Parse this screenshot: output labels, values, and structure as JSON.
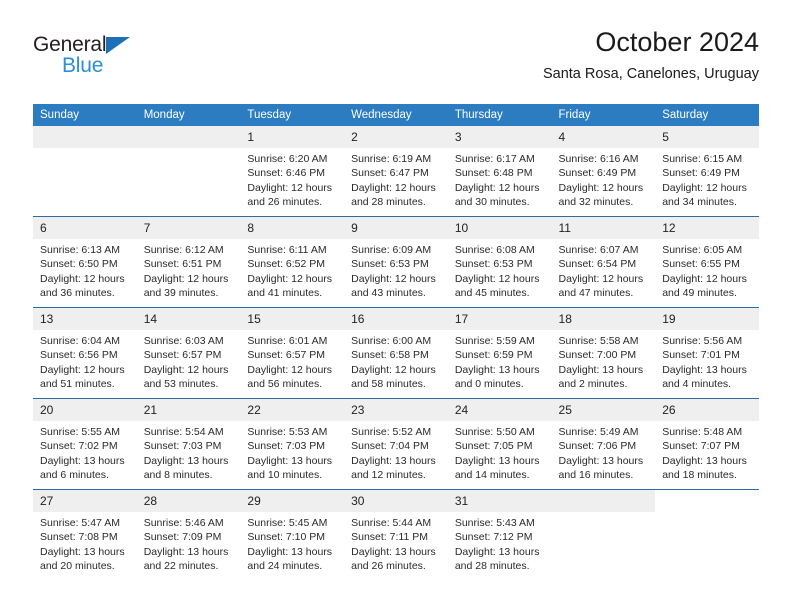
{
  "brand": {
    "word1": "General",
    "word2": "Blue",
    "triangle_color": "#1d6fb8",
    "blue_color": "#2b8fd6"
  },
  "header": {
    "title": "October 2024",
    "subtitle": "Santa Rosa, Canelones, Uruguay",
    "header_bg": "#2b7cc0",
    "row_divider_color": "#2b6ca8",
    "daynum_bg": "#efefef"
  },
  "weekdays": [
    "Sunday",
    "Monday",
    "Tuesday",
    "Wednesday",
    "Thursday",
    "Friday",
    "Saturday"
  ],
  "weeks": [
    [
      {
        "type": "empty"
      },
      {
        "type": "empty"
      },
      {
        "type": "day",
        "date": "1",
        "sunrise": "Sunrise: 6:20 AM",
        "sunset": "Sunset: 6:46 PM",
        "daylight": "Daylight: 12 hours and 26 minutes."
      },
      {
        "type": "day",
        "date": "2",
        "sunrise": "Sunrise: 6:19 AM",
        "sunset": "Sunset: 6:47 PM",
        "daylight": "Daylight: 12 hours and 28 minutes."
      },
      {
        "type": "day",
        "date": "3",
        "sunrise": "Sunrise: 6:17 AM",
        "sunset": "Sunset: 6:48 PM",
        "daylight": "Daylight: 12 hours and 30 minutes."
      },
      {
        "type": "day",
        "date": "4",
        "sunrise": "Sunrise: 6:16 AM",
        "sunset": "Sunset: 6:49 PM",
        "daylight": "Daylight: 12 hours and 32 minutes."
      },
      {
        "type": "day",
        "date": "5",
        "sunrise": "Sunrise: 6:15 AM",
        "sunset": "Sunset: 6:49 PM",
        "daylight": "Daylight: 12 hours and 34 minutes."
      }
    ],
    [
      {
        "type": "day",
        "date": "6",
        "sunrise": "Sunrise: 6:13 AM",
        "sunset": "Sunset: 6:50 PM",
        "daylight": "Daylight: 12 hours and 36 minutes."
      },
      {
        "type": "day",
        "date": "7",
        "sunrise": "Sunrise: 6:12 AM",
        "sunset": "Sunset: 6:51 PM",
        "daylight": "Daylight: 12 hours and 39 minutes."
      },
      {
        "type": "day",
        "date": "8",
        "sunrise": "Sunrise: 6:11 AM",
        "sunset": "Sunset: 6:52 PM",
        "daylight": "Daylight: 12 hours and 41 minutes."
      },
      {
        "type": "day",
        "date": "9",
        "sunrise": "Sunrise: 6:09 AM",
        "sunset": "Sunset: 6:53 PM",
        "daylight": "Daylight: 12 hours and 43 minutes."
      },
      {
        "type": "day",
        "date": "10",
        "sunrise": "Sunrise: 6:08 AM",
        "sunset": "Sunset: 6:53 PM",
        "daylight": "Daylight: 12 hours and 45 minutes."
      },
      {
        "type": "day",
        "date": "11",
        "sunrise": "Sunrise: 6:07 AM",
        "sunset": "Sunset: 6:54 PM",
        "daylight": "Daylight: 12 hours and 47 minutes."
      },
      {
        "type": "day",
        "date": "12",
        "sunrise": "Sunrise: 6:05 AM",
        "sunset": "Sunset: 6:55 PM",
        "daylight": "Daylight: 12 hours and 49 minutes."
      }
    ],
    [
      {
        "type": "day",
        "date": "13",
        "sunrise": "Sunrise: 6:04 AM",
        "sunset": "Sunset: 6:56 PM",
        "daylight": "Daylight: 12 hours and 51 minutes."
      },
      {
        "type": "day",
        "date": "14",
        "sunrise": "Sunrise: 6:03 AM",
        "sunset": "Sunset: 6:57 PM",
        "daylight": "Daylight: 12 hours and 53 minutes."
      },
      {
        "type": "day",
        "date": "15",
        "sunrise": "Sunrise: 6:01 AM",
        "sunset": "Sunset: 6:57 PM",
        "daylight": "Daylight: 12 hours and 56 minutes."
      },
      {
        "type": "day",
        "date": "16",
        "sunrise": "Sunrise: 6:00 AM",
        "sunset": "Sunset: 6:58 PM",
        "daylight": "Daylight: 12 hours and 58 minutes."
      },
      {
        "type": "day",
        "date": "17",
        "sunrise": "Sunrise: 5:59 AM",
        "sunset": "Sunset: 6:59 PM",
        "daylight": "Daylight: 13 hours and 0 minutes."
      },
      {
        "type": "day",
        "date": "18",
        "sunrise": "Sunrise: 5:58 AM",
        "sunset": "Sunset: 7:00 PM",
        "daylight": "Daylight: 13 hours and 2 minutes."
      },
      {
        "type": "day",
        "date": "19",
        "sunrise": "Sunrise: 5:56 AM",
        "sunset": "Sunset: 7:01 PM",
        "daylight": "Daylight: 13 hours and 4 minutes."
      }
    ],
    [
      {
        "type": "day",
        "date": "20",
        "sunrise": "Sunrise: 5:55 AM",
        "sunset": "Sunset: 7:02 PM",
        "daylight": "Daylight: 13 hours and 6 minutes."
      },
      {
        "type": "day",
        "date": "21",
        "sunrise": "Sunrise: 5:54 AM",
        "sunset": "Sunset: 7:03 PM",
        "daylight": "Daylight: 13 hours and 8 minutes."
      },
      {
        "type": "day",
        "date": "22",
        "sunrise": "Sunrise: 5:53 AM",
        "sunset": "Sunset: 7:03 PM",
        "daylight": "Daylight: 13 hours and 10 minutes."
      },
      {
        "type": "day",
        "date": "23",
        "sunrise": "Sunrise: 5:52 AM",
        "sunset": "Sunset: 7:04 PM",
        "daylight": "Daylight: 13 hours and 12 minutes."
      },
      {
        "type": "day",
        "date": "24",
        "sunrise": "Sunrise: 5:50 AM",
        "sunset": "Sunset: 7:05 PM",
        "daylight": "Daylight: 13 hours and 14 minutes."
      },
      {
        "type": "day",
        "date": "25",
        "sunrise": "Sunrise: 5:49 AM",
        "sunset": "Sunset: 7:06 PM",
        "daylight": "Daylight: 13 hours and 16 minutes."
      },
      {
        "type": "day",
        "date": "26",
        "sunrise": "Sunrise: 5:48 AM",
        "sunset": "Sunset: 7:07 PM",
        "daylight": "Daylight: 13 hours and 18 minutes."
      }
    ],
    [
      {
        "type": "day",
        "date": "27",
        "sunrise": "Sunrise: 5:47 AM",
        "sunset": "Sunset: 7:08 PM",
        "daylight": "Daylight: 13 hours and 20 minutes."
      },
      {
        "type": "day",
        "date": "28",
        "sunrise": "Sunrise: 5:46 AM",
        "sunset": "Sunset: 7:09 PM",
        "daylight": "Daylight: 13 hours and 22 minutes."
      },
      {
        "type": "day",
        "date": "29",
        "sunrise": "Sunrise: 5:45 AM",
        "sunset": "Sunset: 7:10 PM",
        "daylight": "Daylight: 13 hours and 24 minutes."
      },
      {
        "type": "day",
        "date": "30",
        "sunrise": "Sunrise: 5:44 AM",
        "sunset": "Sunset: 7:11 PM",
        "daylight": "Daylight: 13 hours and 26 minutes."
      },
      {
        "type": "day",
        "date": "31",
        "sunrise": "Sunrise: 5:43 AM",
        "sunset": "Sunset: 7:12 PM",
        "daylight": "Daylight: 13 hours and 28 minutes."
      },
      {
        "type": "empty"
      },
      {
        "type": "blank"
      }
    ]
  ]
}
